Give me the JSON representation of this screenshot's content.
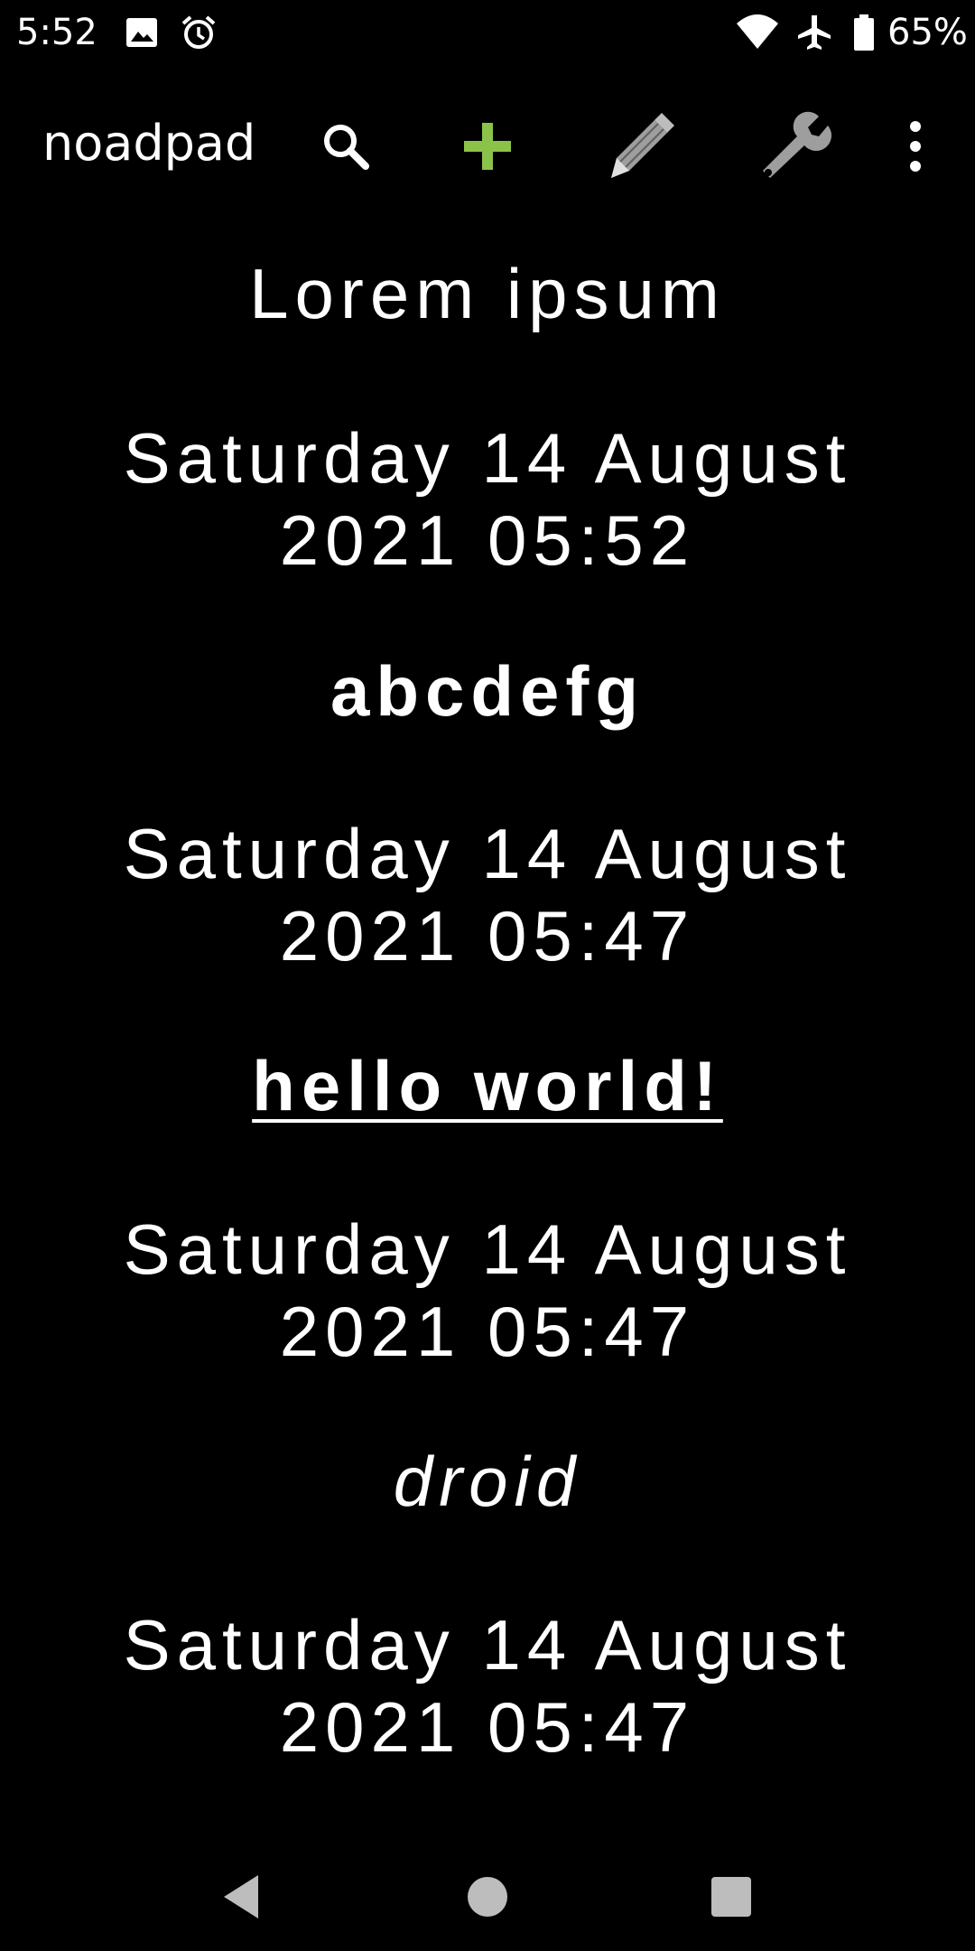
{
  "status_bar": {
    "time": "5:52",
    "battery": "65%",
    "icons": [
      "image-icon",
      "alarm-icon",
      "wifi-icon",
      "airplane-icon",
      "battery-icon"
    ]
  },
  "toolbar": {
    "title": "noadpad",
    "actions": [
      "search-icon",
      "add-icon",
      "edit-icon",
      "settings-icon",
      "more-icon"
    ],
    "add_color": "#8bc34a",
    "icon_color": "#9e9e9e"
  },
  "note": {
    "lines": [
      "Lorem ipsum",
      "Saturday 14 August",
      "2021 05:52",
      "abcdefg",
      "Saturday 14 August",
      "2021 05:47",
      "hello world!",
      "Saturday 14 August",
      "2021 05:47",
      "droid",
      "Saturday 14 August",
      "2021 05:47"
    ]
  },
  "nav_bar": {
    "buttons": [
      "back-icon",
      "home-icon",
      "recents-icon"
    ]
  }
}
